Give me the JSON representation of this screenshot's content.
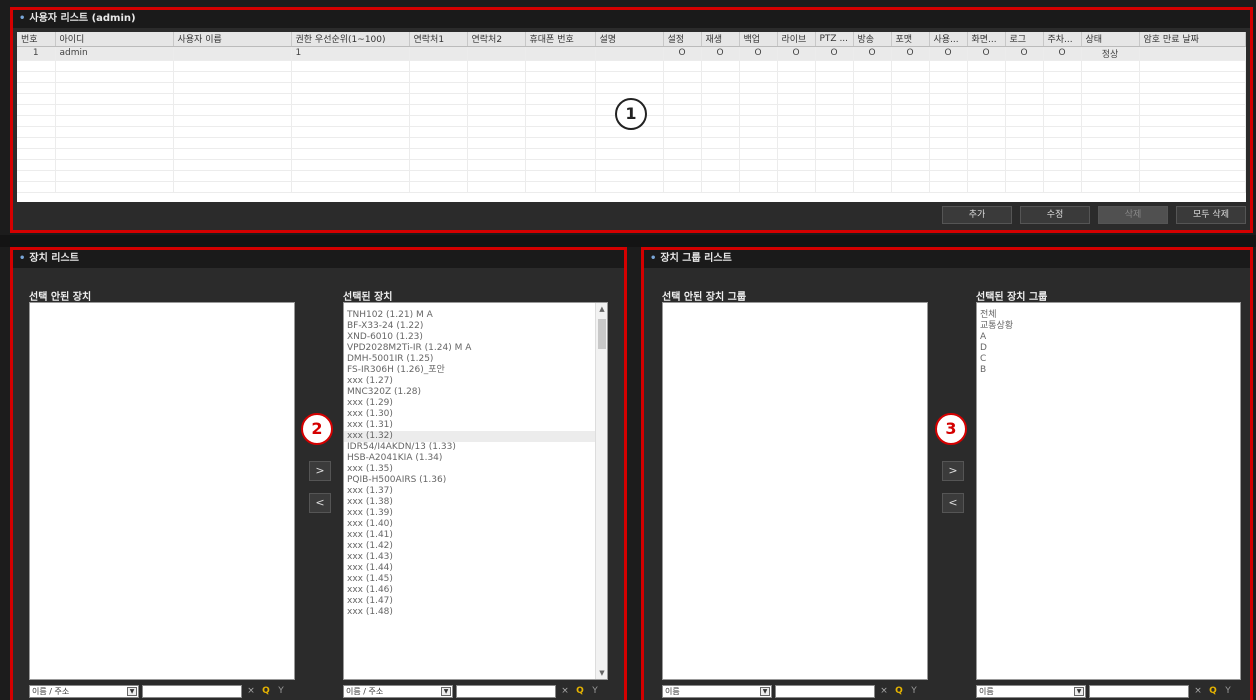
{
  "user_panel": {
    "title": "사용자 리스트 (admin)",
    "columns": [
      "번호",
      "아이디",
      "사용자 이름",
      "권한 우선순위(1~100)",
      "연락처1",
      "연락처2",
      "휴대폰 번호",
      "설명",
      "설정",
      "재생",
      "백업",
      "라이브",
      "PTZ ...",
      "방송",
      "포맷",
      "사용...",
      "화면...",
      "로그",
      "주차...",
      "상태",
      "암호 만료 날짜"
    ],
    "rows": [
      [
        "1",
        "admin",
        "",
        "1",
        "",
        "",
        "",
        "",
        "O",
        "O",
        "O",
        "O",
        "O",
        "O",
        "O",
        "O",
        "O",
        "O",
        "O",
        "정상",
        ""
      ]
    ],
    "buttons": {
      "add": "추가",
      "edit": "수정",
      "delete": "삭제",
      "delete_all": "모두 삭제"
    },
    "callout": "1"
  },
  "device_panel": {
    "title": "장치 리스트",
    "unselected_label": "선택 안된 장치",
    "selected_label": "선택된 장치",
    "selected_items": [
      "TNH102 (1.21) M A",
      "BF-X33-24 (1.22)",
      "XND-6010 (1.23)",
      "VPD2028M2Ti-IR (1.24) M A",
      "DMH-5001IR (1.25)",
      "FS-IR306H (1.26)_포안",
      "xxx (1.27)",
      "MNC320Z (1.28)",
      "xxx (1.29)",
      "xxx (1.30)",
      "xxx (1.31)",
      "xxx (1.32)",
      "IDR54/I4AKDN/13 (1.33)",
      "HSB-A2041KIA (1.34)",
      "xxx (1.35)",
      "PQIB-H500AIRS (1.36)",
      "xxx (1.37)",
      "xxx (1.38)",
      "xxx (1.39)",
      "xxx (1.40)",
      "xxx (1.41)",
      "xxx (1.42)",
      "xxx (1.43)",
      "xxx (1.44)",
      "xxx (1.45)",
      "xxx (1.46)",
      "xxx (1.47)",
      "xxx (1.48)"
    ],
    "highlighted_index": 11,
    "search_select_left": "이름 / 주소",
    "search_select_right": "이름 / 주소",
    "move_right": ">",
    "move_left": "<",
    "callout": "2"
  },
  "group_panel": {
    "title": "장치 그룹 리스트",
    "unselected_label": "선택 안된 장치 그룹",
    "selected_label": "선택된 장치 그룹",
    "selected_items": [
      "전체",
      "교통상황",
      "A",
      "D",
      "C",
      "B"
    ],
    "search_select_left": "이름",
    "search_select_right": "이름",
    "move_right": ">",
    "move_left": "<",
    "callout": "3"
  },
  "icons": {
    "clear": "×",
    "search": "Q",
    "filter": "Y",
    "caret": "▼",
    "scroll_up": "▲",
    "scroll_down": "▼"
  }
}
